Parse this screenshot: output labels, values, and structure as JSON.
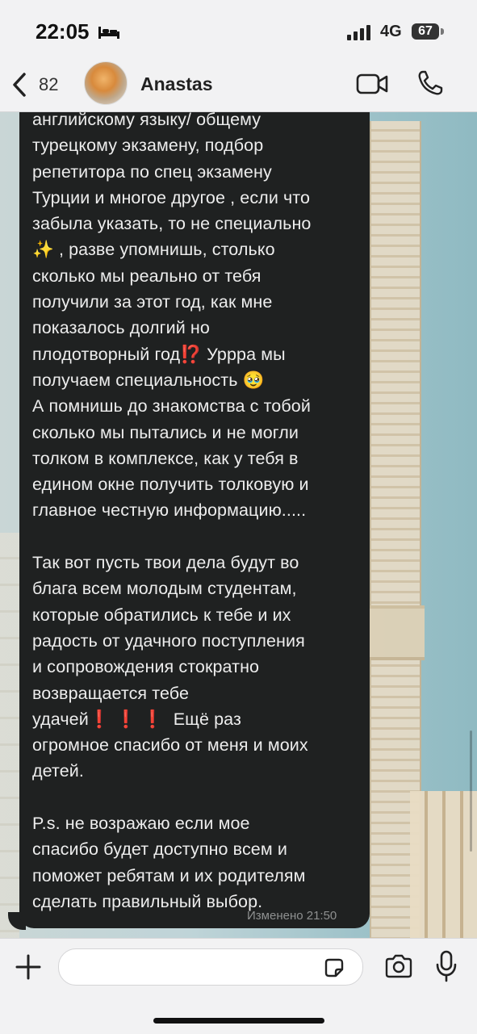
{
  "status_bar": {
    "time": "22:05",
    "network": "4G",
    "battery": "67"
  },
  "header": {
    "back_count": "82",
    "contact_name": "Anastas"
  },
  "message": {
    "text": "английскому языку/ общему\nтурецкому экзамену, подбор\nрепетитора по спец экзамену\nТурции и многое другое , если что\nзабыла указать, то не специально\n✨ , разве упомнишь, столько\nсколько мы реально от тебя\nполучили за этот год, как мне\nпоказалось долгий но\nплодотворный год⁉️ Уррра мы\nполучаем специальность 🥹\nА помнишь до знакомства с тобой\nсколько мы пытались и не могли\nтолком в комплексе, как у тебя в\nедином окне получить толковую и\nглавное честную информацию.....\n\nТак вот пусть твои дела будут во\nблага всем молодым студентам,\nкоторые обратились к тебе и их\nрадость от удачного поступления\nи сопровождения стократно\nвозвращается тебе\nудачей❗️ ❗️ ❗️  Ещё раз\nогромное спасибо от меня и моих\nдетей.\n\nP.s. не возражаю если мое\nспасибо будет доступно всем и\nпоможет ребятам и их родителям\nсделать правильный выбор.",
    "edited_label": "Изменено 21:50"
  },
  "colors": {
    "bubble": "#1f2121",
    "bar": "#f2f2f3",
    "accent": "#1a1a1a"
  }
}
